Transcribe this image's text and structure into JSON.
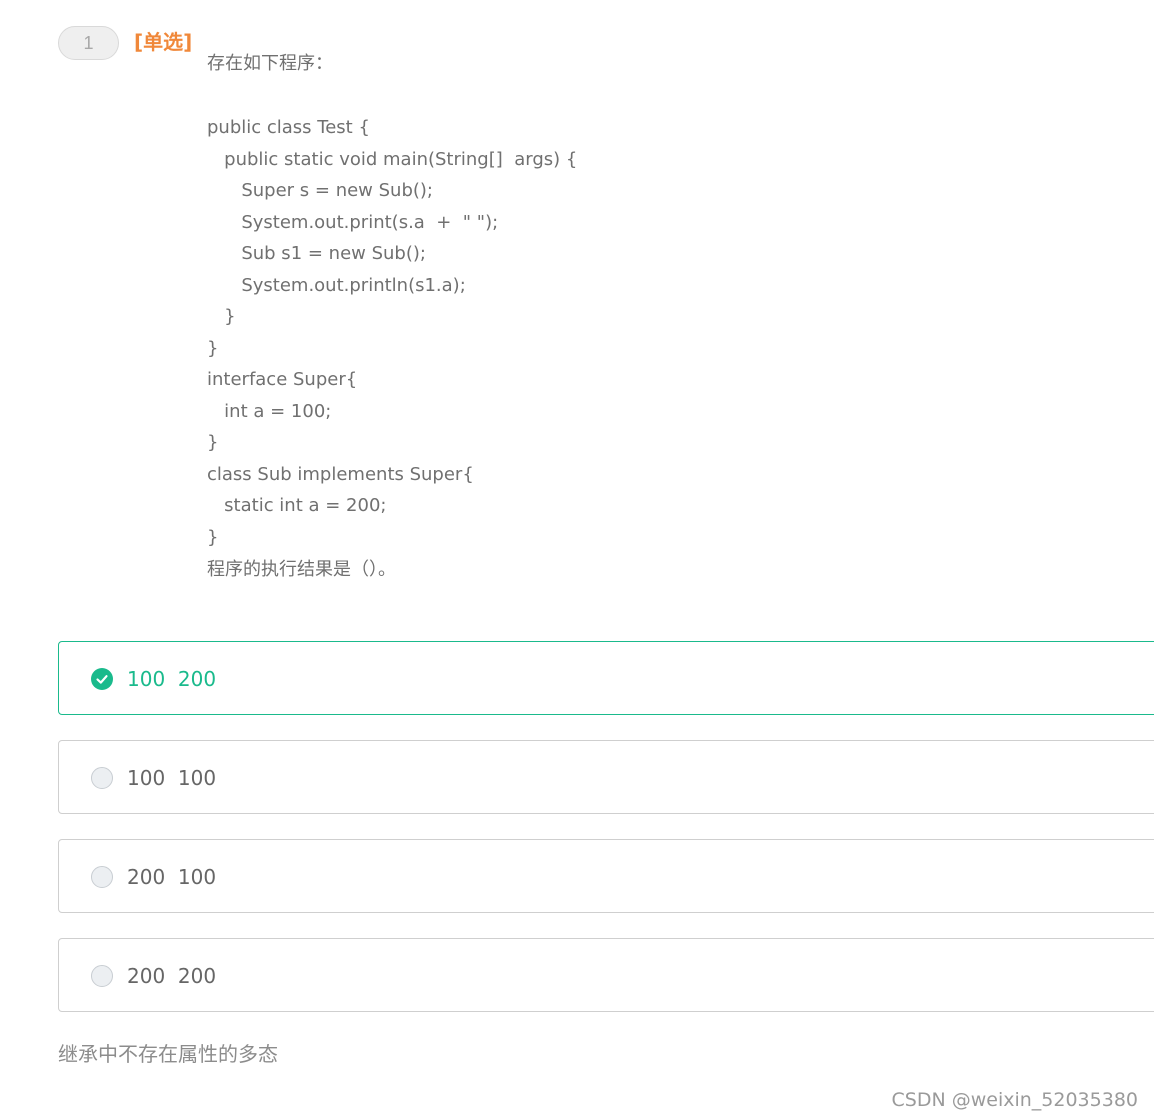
{
  "question": {
    "number": "1",
    "type_label": "[单选]",
    "lines": [
      "存在如下程序：",
      "",
      "public class Test {",
      "   public static void main(String[]  args) {",
      "      Super s = new Sub();",
      "      System.out.print(s.a  +  \" \");",
      "      Sub s1 = new Sub();",
      "      System.out.println(s1.a);",
      "   }",
      "}",
      "interface Super{",
      "   int a = 100;",
      "}",
      "class Sub implements Super{",
      "   static int a = 200;",
      "}",
      "程序的执行结果是（）。"
    ]
  },
  "options": [
    {
      "label": "100  200",
      "selected": true
    },
    {
      "label": "100  100",
      "selected": false
    },
    {
      "label": "200  100",
      "selected": false
    },
    {
      "label": "200  200",
      "selected": false
    }
  ],
  "analysis": "继承中不存在属性的多态",
  "watermark": "CSDN @weixin_52035380",
  "colors": {
    "accent": "#1aba8c",
    "type_label": "#f0883a",
    "text": "#666666"
  }
}
